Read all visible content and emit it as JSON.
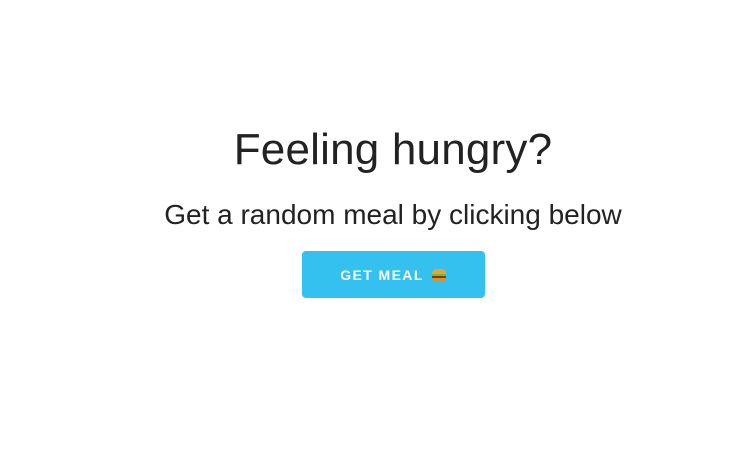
{
  "hero": {
    "title": "Feeling hungry?",
    "subtitle": "Get a random meal by clicking below",
    "button": {
      "label": "GET MEAL",
      "icon": "hamburger-icon",
      "color": "#35c1ef"
    }
  }
}
